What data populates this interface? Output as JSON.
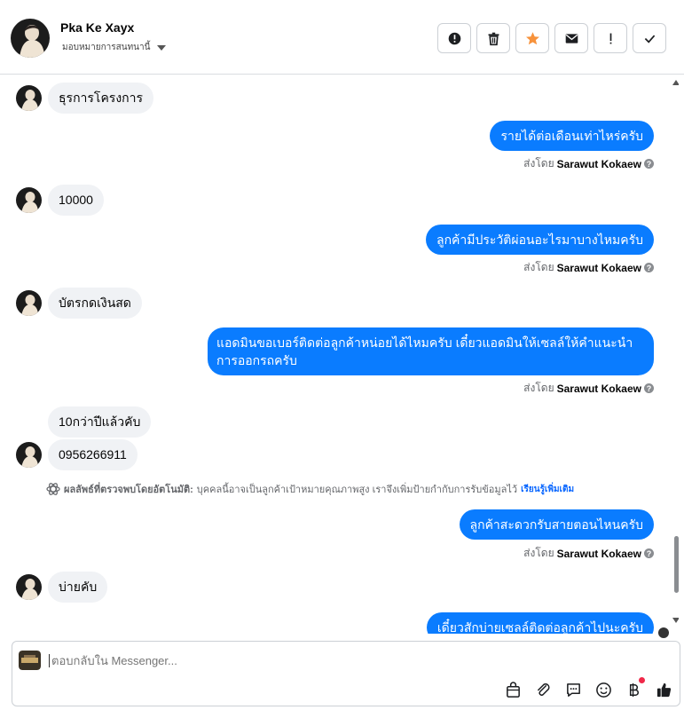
{
  "header": {
    "name": "Pka Ke Xayx",
    "assign_label": "มอบหมายการสนทนานี้",
    "actions": [
      {
        "icon": "alert-circle-icon",
        "name": "mark-spam-button"
      },
      {
        "icon": "trash-icon",
        "name": "delete-button"
      },
      {
        "icon": "star-icon",
        "name": "star-button"
      },
      {
        "icon": "envelope-icon",
        "name": "mark-unread-button"
      },
      {
        "icon": "exclamation-icon",
        "name": "follow-up-button"
      },
      {
        "icon": "check-icon",
        "name": "mark-done-button"
      }
    ],
    "star_color": "#f7923b"
  },
  "messages": {
    "m1": "ธุรการโครงการ",
    "m2": "รายได้ต่อเดือนเท่าไหร่ครับ",
    "m3": "10000",
    "m4": "ลูกค้ามีประวัติผ่อนอะไรมาบางไหมครับ",
    "m5": "บัตรกดเงินสด",
    "m6": "แอดมินขอเบอร์ติดต่อลูกค้าหน่อยได้ไหมครับ เดี๋ยวแอดมินให้เซลล์ให้คำแนะนำการออกรถครับ",
    "m7": "10กว่าปีแล้วคับ",
    "m8": "0956266911",
    "m9": "ลูกค้าสะดวกรับสายตอนไหนครับ",
    "m10": "บ่ายคับ",
    "m11": "เดี๋ยวสักบ่ายเซลล์ติดต่อลูกค้าไปนะครับ"
  },
  "sent_by": {
    "prefix": "ส่งโดย",
    "agent": "Sarawut Kokaew",
    "help": "?"
  },
  "auto_note": {
    "title": "ผลลัพธ์ที่ตรวจพบโดยอัตโนมัติ:",
    "text": "บุคคลนี้อาจเป็นลูกค้าเป้าหมายคุณภาพสูง เราจึงเพิ่มป้ายกำกับการรับข้อมูลไว้",
    "link": "เรียนรู้เพิ่มเติม"
  },
  "composer": {
    "placeholder": "ตอบกลับใน Messenger...",
    "tools": [
      "shop-bag-icon",
      "paperclip-icon",
      "saved-reply-icon",
      "emoji-icon",
      "baht-icon",
      "thumbs-up-icon"
    ]
  },
  "colors": {
    "outgoing_bubble": "#0a7cff",
    "incoming_bubble": "#f0f2f5",
    "link": "#0866ff"
  }
}
